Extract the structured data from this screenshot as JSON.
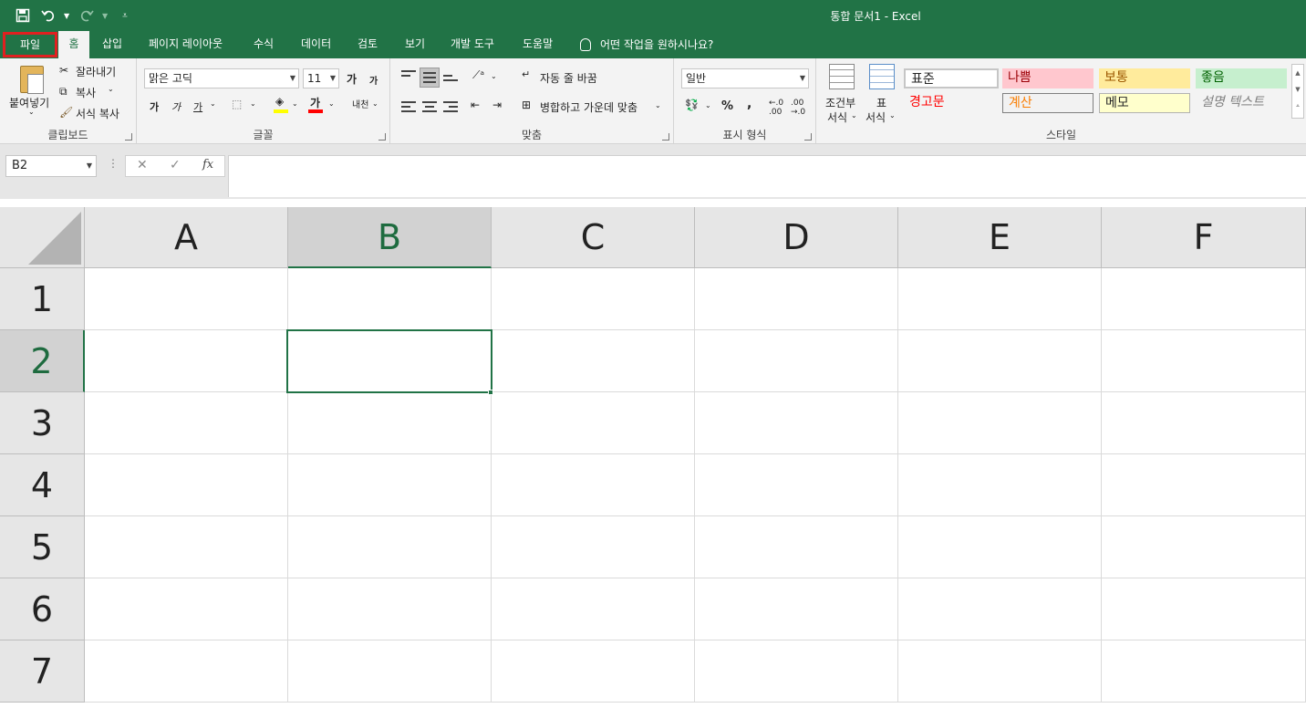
{
  "window": {
    "title": "통합 문서1  -  Excel"
  },
  "quick_access": {
    "save_icon": "save-icon",
    "undo_icon": "undo-icon",
    "redo_icon": "redo-icon",
    "customize_icon": "customize-qat-icon"
  },
  "tabs": [
    {
      "label": "파일"
    },
    {
      "label": "홈"
    },
    {
      "label": "삽입"
    },
    {
      "label": "페이지 레이아웃"
    },
    {
      "label": "수식"
    },
    {
      "label": "데이터"
    },
    {
      "label": "검토"
    },
    {
      "label": "보기"
    },
    {
      "label": "개발 도구"
    },
    {
      "label": "도움말"
    }
  ],
  "tell_me": {
    "text": "어떤 작업을 원하시나요?"
  },
  "clipboard": {
    "paste": "붙여넣기",
    "cut": "잘라내기",
    "copy": "복사",
    "format_painter": "서식 복사",
    "label": "클립보드"
  },
  "font": {
    "name": "맑은 고딕",
    "size": "11",
    "grow": "가",
    "shrink": "가",
    "bold": "가",
    "italic": "가",
    "underline": "가",
    "font_color": "가",
    "phonetic": "내천",
    "label": "글꼴"
  },
  "alignment": {
    "wrap_text": "자동 줄 바꿈",
    "merge_center": "병합하고 가운데 맞춤",
    "label": "맞춤"
  },
  "number": {
    "format": "일반",
    "percent": "%",
    "comma": ",",
    "label": "표시 형식"
  },
  "styles": {
    "conditional": "조건부 서식",
    "conditional_line1": "조건부",
    "conditional_line2": "서식",
    "as_table_line1": "표",
    "as_table_line2": "서식",
    "cells": [
      {
        "label": "표준",
        "color": "#000000",
        "bg": "#ffffff"
      },
      {
        "label": "나쁨",
        "color": "#9c0006",
        "bg": "#ffc7ce"
      },
      {
        "label": "보통",
        "color": "#9c5700",
        "bg": "#ffeb9c"
      },
      {
        "label": "좋음",
        "color": "#006100",
        "bg": "#c6efce"
      },
      {
        "label": "경고문",
        "color": "#ff0000",
        "bg": "#f3f3f3"
      },
      {
        "label": "계산",
        "color": "#fa7d00",
        "bg": "#f2f2f2"
      },
      {
        "label": "메모",
        "color": "#000000",
        "bg": "#ffffcc"
      },
      {
        "label": "설명 텍스트",
        "color": "#7f7f7f",
        "bg": "#f3f3f3"
      }
    ],
    "label": "스타일"
  },
  "formula_bar": {
    "name_box": "B2",
    "cancel": "✕",
    "enter": "✓",
    "fx": "fx",
    "content": ""
  },
  "sheet": {
    "columns": [
      "A",
      "B",
      "C",
      "D",
      "E",
      "F"
    ],
    "rows": [
      "1",
      "2",
      "3",
      "4",
      "5",
      "6",
      "7"
    ],
    "selected_cell": "B2",
    "accent": "#217346"
  }
}
